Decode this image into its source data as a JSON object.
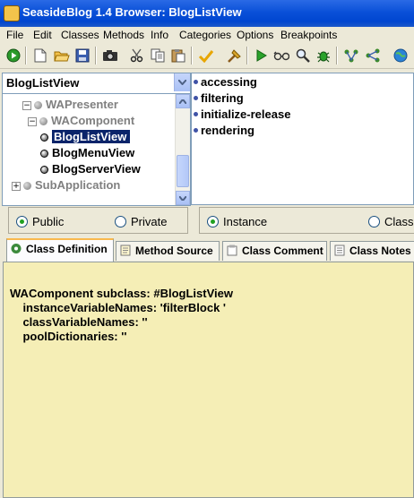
{
  "window": {
    "title": "SeasideBlog 1.4 Browser: BlogListView"
  },
  "menu": [
    "File",
    "Edit",
    "Classes",
    "Methods",
    "Info",
    "Categories",
    "Options",
    "Breakpoints"
  ],
  "class_selector": {
    "value": "BlogListView"
  },
  "tree": {
    "items": [
      {
        "label": "WAPresenter"
      },
      {
        "label": "WAComponent"
      },
      {
        "label": "BlogListView"
      },
      {
        "label": "BlogMenuView"
      },
      {
        "label": "BlogServerView"
      },
      {
        "label": "SubApplication"
      }
    ],
    "expander_minus": "−",
    "expander_plus": "+"
  },
  "categories": [
    "accessing",
    "filtering",
    "initialize-release",
    "rendering"
  ],
  "visibility": {
    "public": "Public",
    "private": "Private"
  },
  "scope": {
    "instance": "Instance",
    "class": "Class"
  },
  "tabs": [
    "Class Definition",
    "Method Source",
    "Class Comment",
    "Class Notes"
  ],
  "editor": {
    "lines": [
      "WAComponent subclass: #BlogListView",
      "    instanceVariableNames: 'filterBlock '",
      "    classVariableNames: ''",
      "    poolDictionaries: ''"
    ]
  },
  "colors": {
    "title_bar": "#0a50d8",
    "selection": "#0a246a",
    "editor_bg": "#f5eeb6",
    "tab_highlight": "#f9b84d"
  }
}
